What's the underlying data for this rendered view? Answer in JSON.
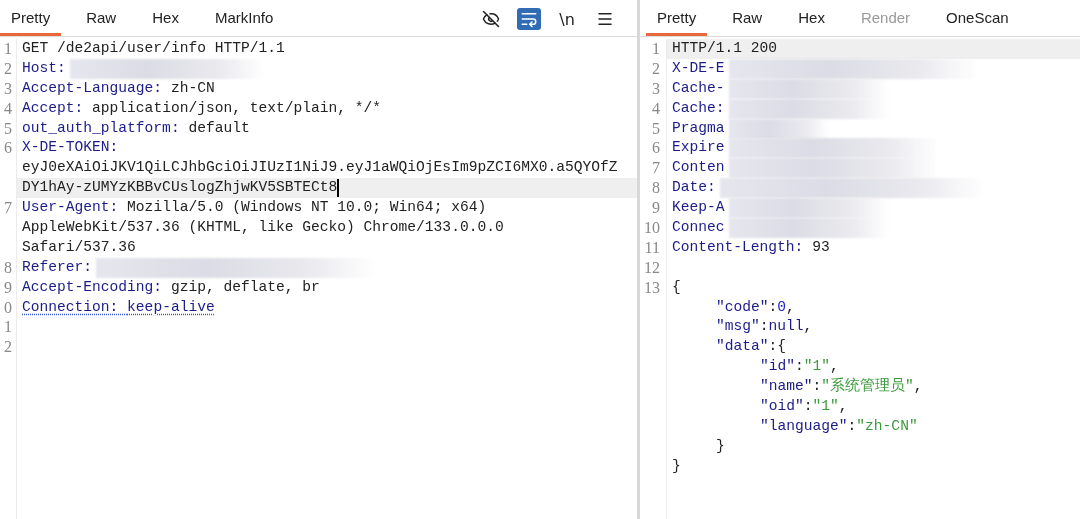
{
  "request": {
    "tabs": [
      {
        "label": "Pretty",
        "selected": true
      },
      {
        "label": "Raw",
        "selected": false
      },
      {
        "label": "Hex",
        "selected": false
      },
      {
        "label": "MarkInfo",
        "selected": false
      }
    ],
    "toolbar": [
      {
        "kind": "icon",
        "on": false
      },
      {
        "kind": "icon",
        "on": true
      },
      {
        "kind": "text",
        "label": "\\n",
        "on": false
      },
      {
        "kind": "icon",
        "on": false
      }
    ],
    "lines": [
      {
        "number": "1",
        "rows": [
          "GET /de2api/user/info HTTP/1.1"
        ]
      },
      {
        "number": "2",
        "key": "Host:",
        "redacted": true
      },
      {
        "number": "3",
        "key": "Accept-Language:",
        "rows": [
          "zh-CN"
        ]
      },
      {
        "number": "4",
        "key": "Accept:",
        "rows": [
          "application/json, text/plain, */*"
        ]
      },
      {
        "number": "5",
        "key": "out_auth_platform:",
        "rows": [
          "default"
        ]
      },
      {
        "number": "6",
        "key": "X-DE-TOKEN:",
        "wrapped": true,
        "rows": [
          "eyJ0eXAiOiJKV1QiLCJhbGciOiJIUzI1NiJ9.eyJ1aWQiOjEsIm9pZCI6MX0.a5QYOfZ",
          "DY1hAy-zUMYzKBBvCUslogZhjwKV5SBTECt8"
        ],
        "current": true
      },
      {
        "number": "7",
        "key": "User-Agent:",
        "rows": [
          "Mozilla/5.0 (Windows NT 10.0; Win64; x64)",
          "AppleWebKit/537.36 (KHTML, like Gecko) Chrome/133.0.0.0",
          "Safari/537.36"
        ]
      },
      {
        "number": "8",
        "key": "Referer:",
        "redacted": true
      },
      {
        "number": "9",
        "key": "Accept-Encoding:",
        "rows": [
          "gzip, deflate, br"
        ]
      },
      {
        "number": "0",
        "key": "Connection:",
        "rows": [
          "keep-alive"
        ],
        "flagged": true
      },
      {
        "number": "1"
      },
      {
        "number": "2"
      }
    ]
  },
  "response": {
    "tabs": [
      {
        "label": "Pretty",
        "selected": true,
        "disabled": false
      },
      {
        "label": "Raw",
        "selected": false,
        "disabled": false
      },
      {
        "label": "Hex",
        "selected": false,
        "disabled": false
      },
      {
        "label": "Render",
        "selected": false,
        "disabled": true
      },
      {
        "label": "OneScan",
        "selected": false,
        "disabled": false
      }
    ],
    "lines": [
      {
        "number": "1",
        "text": "HTTP/1.1 200",
        "current": true
      },
      {
        "number": "2",
        "key": "X-DE-E",
        "redacted": true
      },
      {
        "number": "3",
        "key": "Cache-",
        "redacted": true
      },
      {
        "number": "4",
        "key": "Cache:",
        "redacted": true
      },
      {
        "number": "5",
        "key": "Pragma",
        "redacted": true
      },
      {
        "number": "6",
        "key": "Expire",
        "redacted": true
      },
      {
        "number": "7",
        "key": "Conten",
        "redacted": true
      },
      {
        "number": "8",
        "key": "Date:",
        "redacted": true
      },
      {
        "number": "9",
        "key": "Keep-A",
        "redacted": true
      },
      {
        "number": "10",
        "key": "Connec",
        "redacted": true
      },
      {
        "number": "11",
        "key": "Content-Length:",
        "value": "93"
      },
      {
        "number": "12"
      },
      {
        "number": "13",
        "body": {
          "open": "{",
          "close": "}",
          "entries": [
            {
              "tokens": [
                {
                  "kind": "key",
                  "text": "\"code\""
                },
                {
                  "kind": "punct",
                  "text": ":"
                },
                {
                  "kind": "num",
                  "text": "0"
                },
                {
                  "kind": "punct",
                  "text": ","
                }
              ]
            },
            {
              "tokens": [
                {
                  "kind": "key",
                  "text": "\"msg\""
                },
                {
                  "kind": "punct",
                  "text": ":"
                },
                {
                  "kind": "key",
                  "text": "null"
                },
                {
                  "kind": "punct",
                  "text": ","
                }
              ]
            },
            {
              "tokens": [
                {
                  "kind": "key",
                  "text": "\"data\""
                },
                {
                  "kind": "punct",
                  "text": ":{"
                }
              ],
              "close": "}",
              "children": [
                {
                  "tokens": [
                    {
                      "kind": "key",
                      "text": "\"id\""
                    },
                    {
                      "kind": "punct",
                      "text": ":"
                    },
                    {
                      "kind": "str",
                      "text": "\"1\""
                    },
                    {
                      "kind": "punct",
                      "text": ","
                    }
                  ]
                },
                {
                  "tokens": [
                    {
                      "kind": "key",
                      "text": "\"name\""
                    },
                    {
                      "kind": "punct",
                      "text": ":"
                    },
                    {
                      "kind": "str",
                      "text": "\"系统管理员\""
                    },
                    {
                      "kind": "punct",
                      "text": ","
                    }
                  ]
                },
                {
                  "tokens": [
                    {
                      "kind": "key",
                      "text": "\"oid\""
                    },
                    {
                      "kind": "punct",
                      "text": ":"
                    },
                    {
                      "kind": "str",
                      "text": "\"1\""
                    },
                    {
                      "kind": "punct",
                      "text": ","
                    }
                  ]
                },
                {
                  "tokens": [
                    {
                      "kind": "key",
                      "text": "\"language\""
                    },
                    {
                      "kind": "punct",
                      "text": ":"
                    },
                    {
                      "kind": "str",
                      "text": "\"zh-CN\""
                    }
                  ]
                }
              ]
            }
          ]
        }
      }
    ]
  }
}
